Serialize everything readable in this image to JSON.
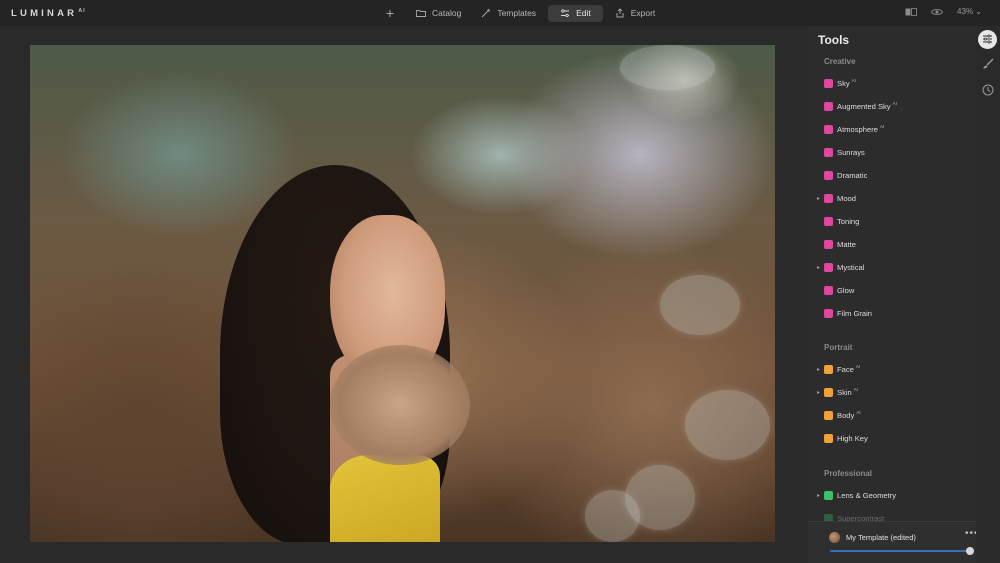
{
  "app": {
    "logo": "LUMINAR",
    "logo_super": "AI"
  },
  "topbar": {
    "plus_label": "+",
    "nav": [
      {
        "label": "Catalog",
        "icon": "folder-icon"
      },
      {
        "label": "Templates",
        "icon": "magic-wand-icon"
      },
      {
        "label": "Edit",
        "icon": "sliders-icon",
        "active": true
      },
      {
        "label": "Export",
        "icon": "export-icon"
      }
    ],
    "zoom": "43%"
  },
  "panel": {
    "title": "Tools",
    "sections": [
      {
        "label": "Creative"
      },
      {
        "label": "Portrait"
      },
      {
        "label": "Professional"
      }
    ],
    "creative_tools": [
      {
        "label": "Sky",
        "ai": "AI",
        "color": "#e0479e",
        "caret": false
      },
      {
        "label": "Augmented Sky",
        "ai": "AI",
        "color": "#e0479e",
        "caret": false
      },
      {
        "label": "Atmosphere",
        "ai": "AI",
        "color": "#e0479e",
        "caret": false
      },
      {
        "label": "Sunrays",
        "ai": "",
        "color": "#e0479e",
        "caret": false
      },
      {
        "label": "Dramatic",
        "ai": "",
        "color": "#e0479e",
        "caret": false
      },
      {
        "label": "Mood",
        "ai": "",
        "color": "#e0479e",
        "caret": true
      },
      {
        "label": "Toning",
        "ai": "",
        "color": "#e0479e",
        "caret": false
      },
      {
        "label": "Matte",
        "ai": "",
        "color": "#e0479e",
        "caret": false
      },
      {
        "label": "Mystical",
        "ai": "",
        "color": "#e0479e",
        "caret": true
      },
      {
        "label": "Glow",
        "ai": "",
        "color": "#e0479e",
        "caret": false
      },
      {
        "label": "Film Grain",
        "ai": "",
        "color": "#e0479e",
        "caret": false
      }
    ],
    "portrait_tools": [
      {
        "label": "Face",
        "ai": "AI",
        "color": "#f0a13a",
        "caret": true
      },
      {
        "label": "Skin",
        "ai": "AI",
        "color": "#f0a13a",
        "caret": true
      },
      {
        "label": "Body",
        "ai": "AI",
        "color": "#f0a13a",
        "caret": false
      },
      {
        "label": "High Key",
        "ai": "",
        "color": "#f0a13a",
        "caret": false
      }
    ],
    "professional_tools": [
      {
        "label": "Lens & Geometry",
        "ai": "",
        "color": "#3fbf6a",
        "caret": true
      },
      {
        "label": "Supercontrast",
        "ai": "",
        "color": "#3fbf6a",
        "caret": false
      }
    ],
    "template": {
      "name": "My Template (edited)",
      "more": "•••",
      "amount": 1.0
    }
  },
  "colors": {
    "accent": "#3b6fb8",
    "creative": "#e0479e",
    "portrait": "#f0a13a",
    "professional": "#3fbf6a"
  }
}
